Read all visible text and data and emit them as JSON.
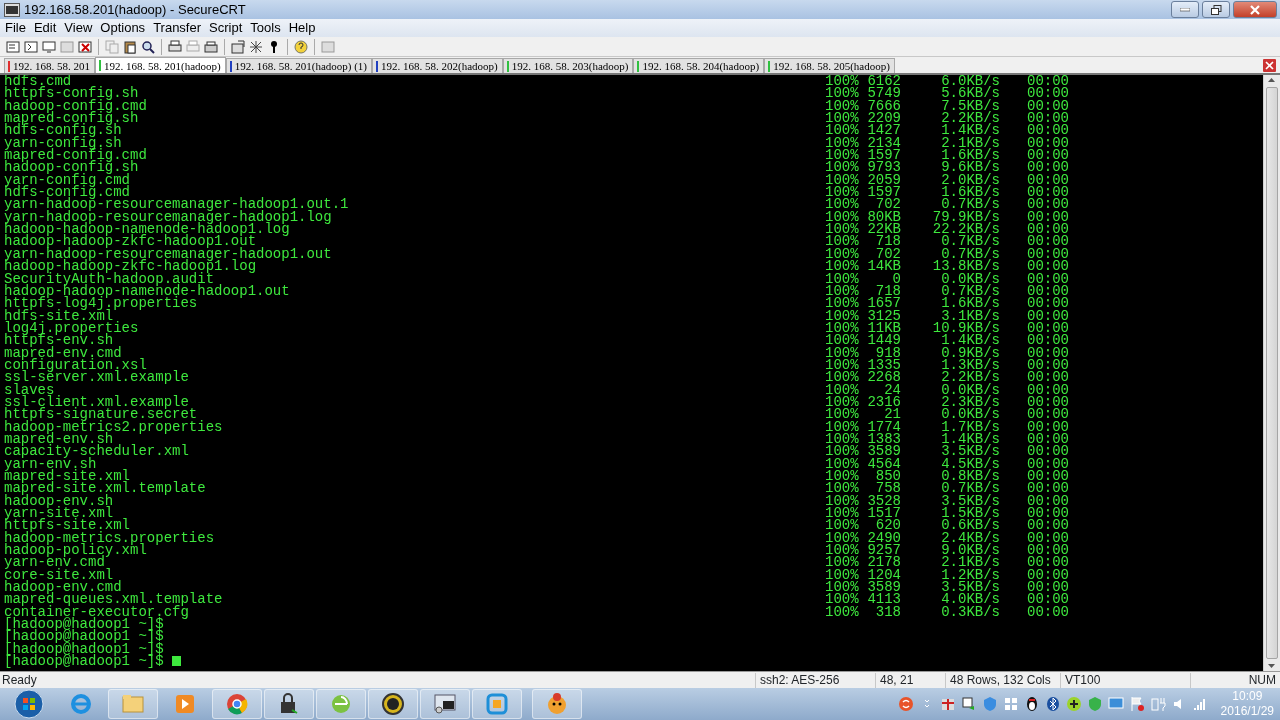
{
  "window": {
    "title": "192.168.58.201(hadoop) - SecureCRT"
  },
  "menu": [
    "File",
    "Edit",
    "View",
    "Options",
    "Transfer",
    "Script",
    "Tools",
    "Help"
  ],
  "tabs": [
    {
      "label": "192. 168. 58. 201",
      "selected": false,
      "color": "#e03030"
    },
    {
      "label": "192. 168. 58. 201(hadoop)",
      "selected": true,
      "color": "#30c040"
    },
    {
      "label": "192. 168. 58. 201(hadoop)  (1)",
      "selected": false,
      "color": "#2040c0"
    },
    {
      "label": "192. 168. 58. 202(hadoop)",
      "selected": false,
      "color": "#2040c0"
    },
    {
      "label": "192. 168. 58. 203(hadoop)",
      "selected": false,
      "color": "#30c040"
    },
    {
      "label": "192. 168. 58. 204(hadoop)",
      "selected": false,
      "color": "#30c040"
    },
    {
      "label": "192. 168. 58. 205(hadoop)",
      "selected": false,
      "color": "#30c040"
    }
  ],
  "terminal": {
    "transfers": [
      {
        "name": "hdfs.cmd",
        "percent": "100%",
        "size": "6162",
        "rate": "6.0KB/s",
        "eta": "00:00"
      },
      {
        "name": "httpfs-config.sh",
        "percent": "100%",
        "size": "5749",
        "rate": "5.6KB/s",
        "eta": "00:00"
      },
      {
        "name": "hadoop-config.cmd",
        "percent": "100%",
        "size": "7666",
        "rate": "7.5KB/s",
        "eta": "00:00"
      },
      {
        "name": "mapred-config.sh",
        "percent": "100%",
        "size": "2209",
        "rate": "2.2KB/s",
        "eta": "00:00"
      },
      {
        "name": "hdfs-config.sh",
        "percent": "100%",
        "size": "1427",
        "rate": "1.4KB/s",
        "eta": "00:00"
      },
      {
        "name": "yarn-config.sh",
        "percent": "100%",
        "size": "2134",
        "rate": "2.1KB/s",
        "eta": "00:00"
      },
      {
        "name": "mapred-config.cmd",
        "percent": "100%",
        "size": "1597",
        "rate": "1.6KB/s",
        "eta": "00:00"
      },
      {
        "name": "hadoop-config.sh",
        "percent": "100%",
        "size": "9793",
        "rate": "9.6KB/s",
        "eta": "00:00"
      },
      {
        "name": "yarn-config.cmd",
        "percent": "100%",
        "size": "2059",
        "rate": "2.0KB/s",
        "eta": "00:00"
      },
      {
        "name": "hdfs-config.cmd",
        "percent": "100%",
        "size": "1597",
        "rate": "1.6KB/s",
        "eta": "00:00"
      },
      {
        "name": "yarn-hadoop-resourcemanager-hadoop1.out.1",
        "percent": "100%",
        "size": "702",
        "rate": "0.7KB/s",
        "eta": "00:00"
      },
      {
        "name": "yarn-hadoop-resourcemanager-hadoop1.log",
        "percent": "100%",
        "size": "80KB",
        "rate": "79.9KB/s",
        "eta": "00:00"
      },
      {
        "name": "hadoop-hadoop-namenode-hadoop1.log",
        "percent": "100%",
        "size": "22KB",
        "rate": "22.2KB/s",
        "eta": "00:00"
      },
      {
        "name": "hadoop-hadoop-zkfc-hadoop1.out",
        "percent": "100%",
        "size": "718",
        "rate": "0.7KB/s",
        "eta": "00:00"
      },
      {
        "name": "yarn-hadoop-resourcemanager-hadoop1.out",
        "percent": "100%",
        "size": "702",
        "rate": "0.7KB/s",
        "eta": "00:00"
      },
      {
        "name": "hadoop-hadoop-zkfc-hadoop1.log",
        "percent": "100%",
        "size": "14KB",
        "rate": "13.8KB/s",
        "eta": "00:00"
      },
      {
        "name": "SecurityAuth-hadoop.audit",
        "percent": "100%",
        "size": "0",
        "rate": "0.0KB/s",
        "eta": "00:00"
      },
      {
        "name": "hadoop-hadoop-namenode-hadoop1.out",
        "percent": "100%",
        "size": "718",
        "rate": "0.7KB/s",
        "eta": "00:00"
      },
      {
        "name": "httpfs-log4j.properties",
        "percent": "100%",
        "size": "1657",
        "rate": "1.6KB/s",
        "eta": "00:00"
      },
      {
        "name": "hdfs-site.xml",
        "percent": "100%",
        "size": "3125",
        "rate": "3.1KB/s",
        "eta": "00:00"
      },
      {
        "name": "log4j.properties",
        "percent": "100%",
        "size": "11KB",
        "rate": "10.9KB/s",
        "eta": "00:00"
      },
      {
        "name": "httpfs-env.sh",
        "percent": "100%",
        "size": "1449",
        "rate": "1.4KB/s",
        "eta": "00:00"
      },
      {
        "name": "mapred-env.cmd",
        "percent": "100%",
        "size": "918",
        "rate": "0.9KB/s",
        "eta": "00:00"
      },
      {
        "name": "configuration.xsl",
        "percent": "100%",
        "size": "1335",
        "rate": "1.3KB/s",
        "eta": "00:00"
      },
      {
        "name": "ssl-server.xml.example",
        "percent": "100%",
        "size": "2268",
        "rate": "2.2KB/s",
        "eta": "00:00"
      },
      {
        "name": "slaves",
        "percent": "100%",
        "size": "24",
        "rate": "0.0KB/s",
        "eta": "00:00"
      },
      {
        "name": "ssl-client.xml.example",
        "percent": "100%",
        "size": "2316",
        "rate": "2.3KB/s",
        "eta": "00:00"
      },
      {
        "name": "httpfs-signature.secret",
        "percent": "100%",
        "size": "21",
        "rate": "0.0KB/s",
        "eta": "00:00"
      },
      {
        "name": "hadoop-metrics2.properties",
        "percent": "100%",
        "size": "1774",
        "rate": "1.7KB/s",
        "eta": "00:00"
      },
      {
        "name": "mapred-env.sh",
        "percent": "100%",
        "size": "1383",
        "rate": "1.4KB/s",
        "eta": "00:00"
      },
      {
        "name": "capacity-scheduler.xml",
        "percent": "100%",
        "size": "3589",
        "rate": "3.5KB/s",
        "eta": "00:00"
      },
      {
        "name": "yarn-env.sh",
        "percent": "100%",
        "size": "4564",
        "rate": "4.5KB/s",
        "eta": "00:00"
      },
      {
        "name": "mapred-site.xml",
        "percent": "100%",
        "size": "850",
        "rate": "0.8KB/s",
        "eta": "00:00"
      },
      {
        "name": "mapred-site.xml.template",
        "percent": "100%",
        "size": "758",
        "rate": "0.7KB/s",
        "eta": "00:00"
      },
      {
        "name": "hadoop-env.sh",
        "percent": "100%",
        "size": "3528",
        "rate": "3.5KB/s",
        "eta": "00:00"
      },
      {
        "name": "yarn-site.xml",
        "percent": "100%",
        "size": "1517",
        "rate": "1.5KB/s",
        "eta": "00:00"
      },
      {
        "name": "httpfs-site.xml",
        "percent": "100%",
        "size": "620",
        "rate": "0.6KB/s",
        "eta": "00:00"
      },
      {
        "name": "hadoop-metrics.properties",
        "percent": "100%",
        "size": "2490",
        "rate": "2.4KB/s",
        "eta": "00:00"
      },
      {
        "name": "hadoop-policy.xml",
        "percent": "100%",
        "size": "9257",
        "rate": "9.0KB/s",
        "eta": "00:00"
      },
      {
        "name": "yarn-env.cmd",
        "percent": "100%",
        "size": "2178",
        "rate": "2.1KB/s",
        "eta": "00:00"
      },
      {
        "name": "core-site.xml",
        "percent": "100%",
        "size": "1204",
        "rate": "1.2KB/s",
        "eta": "00:00"
      },
      {
        "name": "hadoop-env.cmd",
        "percent": "100%",
        "size": "3589",
        "rate": "3.5KB/s",
        "eta": "00:00"
      },
      {
        "name": "mapred-queues.xml.template",
        "percent": "100%",
        "size": "4113",
        "rate": "4.0KB/s",
        "eta": "00:00"
      },
      {
        "name": "container-executor.cfg",
        "percent": "100%",
        "size": "318",
        "rate": "0.3KB/s",
        "eta": "00:00"
      }
    ],
    "prompts": [
      "[hadoop@hadoop1 ~]$",
      "[hadoop@hadoop1 ~]$",
      "[hadoop@hadoop1 ~]$",
      "[hadoop@hadoop1 ~]$"
    ]
  },
  "status_bar": {
    "message": "Ready",
    "cipher": "ssh2: AES-256",
    "position": "48,  21",
    "size": "48 Rows, 132 Cols",
    "emulation": "VT100",
    "num": "NUM"
  },
  "taskbar": {
    "time": "10:09",
    "date": "2016/1/29"
  }
}
